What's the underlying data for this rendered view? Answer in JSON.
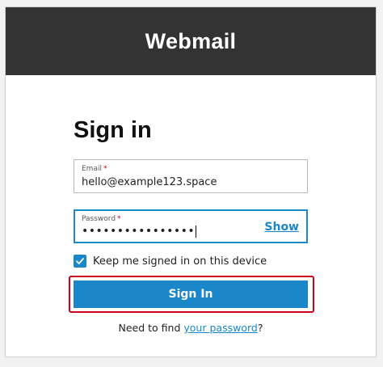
{
  "header": {
    "title": "Webmail"
  },
  "form": {
    "heading": "Sign in",
    "email": {
      "label": "Email",
      "required_mark": "*",
      "value": "hello@example123.space"
    },
    "password": {
      "label": "Password",
      "required_mark": "*",
      "value": "••••••••••••••••",
      "show_label": "Show"
    },
    "keep_signed_in": {
      "label": "Keep me signed in on this device",
      "checked": true
    },
    "submit_label": "Sign In",
    "find_password": {
      "prefix": "Need to find ",
      "link": "your password",
      "suffix": "?"
    }
  },
  "colors": {
    "header_bg": "#333333",
    "accent": "#1a87c8",
    "highlight": "#d0021b"
  }
}
